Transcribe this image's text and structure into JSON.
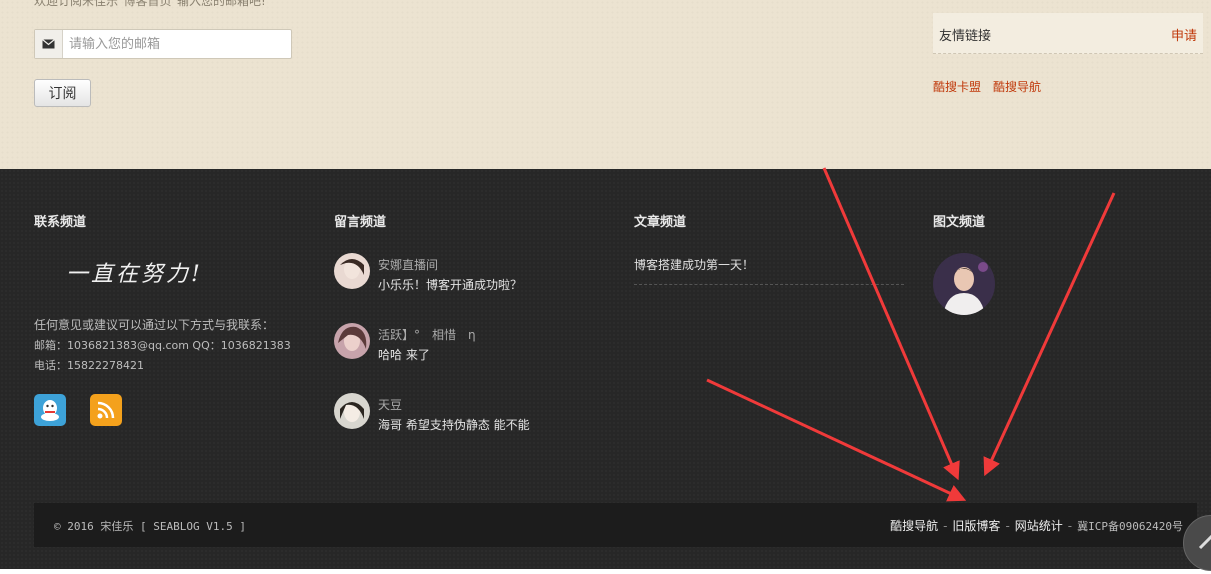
{
  "top": {
    "intro_text": "欢迎订阅宋佳乐\"博客首页\"输入您的邮箱吧!",
    "email_placeholder": "请输入您的邮箱",
    "subscribe_label": "订阅",
    "friends_title": "友情链接",
    "friends_apply": "申请",
    "friend_links": [
      "酷搜卡盟",
      "酷搜导航"
    ]
  },
  "footer": {
    "contact": {
      "title": "联系频道",
      "signature": "一直在努力!",
      "lead": "任何意见或建议可以通过以下方式与我联系：",
      "email": "邮箱：1036821383@qq.com QQ：1036821383",
      "phone": "电话：15822278421"
    },
    "comments": {
      "title": "留言频道",
      "items": [
        {
          "name": "安娜直播间",
          "text": "小乐乐！博客开通成功啦？"
        },
        {
          "name": "活跃】°　相惜　η",
          "text": "哈哈 来了"
        },
        {
          "name": "天豆",
          "text": "海哥 希望支持伪静态 能不能"
        }
      ]
    },
    "articles": {
      "title": "文章频道",
      "items": [
        "博客搭建成功第一天！"
      ]
    },
    "gallery": {
      "title": "图文频道"
    }
  },
  "bottom": {
    "copyright": "© 2016 宋佳乐 [ SEABLOG V1.5 ]",
    "links": [
      "酷搜导航",
      "旧版博客",
      "网站统计"
    ],
    "icp": "冀ICP备09062420号"
  },
  "colors": {
    "accent": "#c0390b",
    "annotation_arrow": "#f03a3a"
  }
}
